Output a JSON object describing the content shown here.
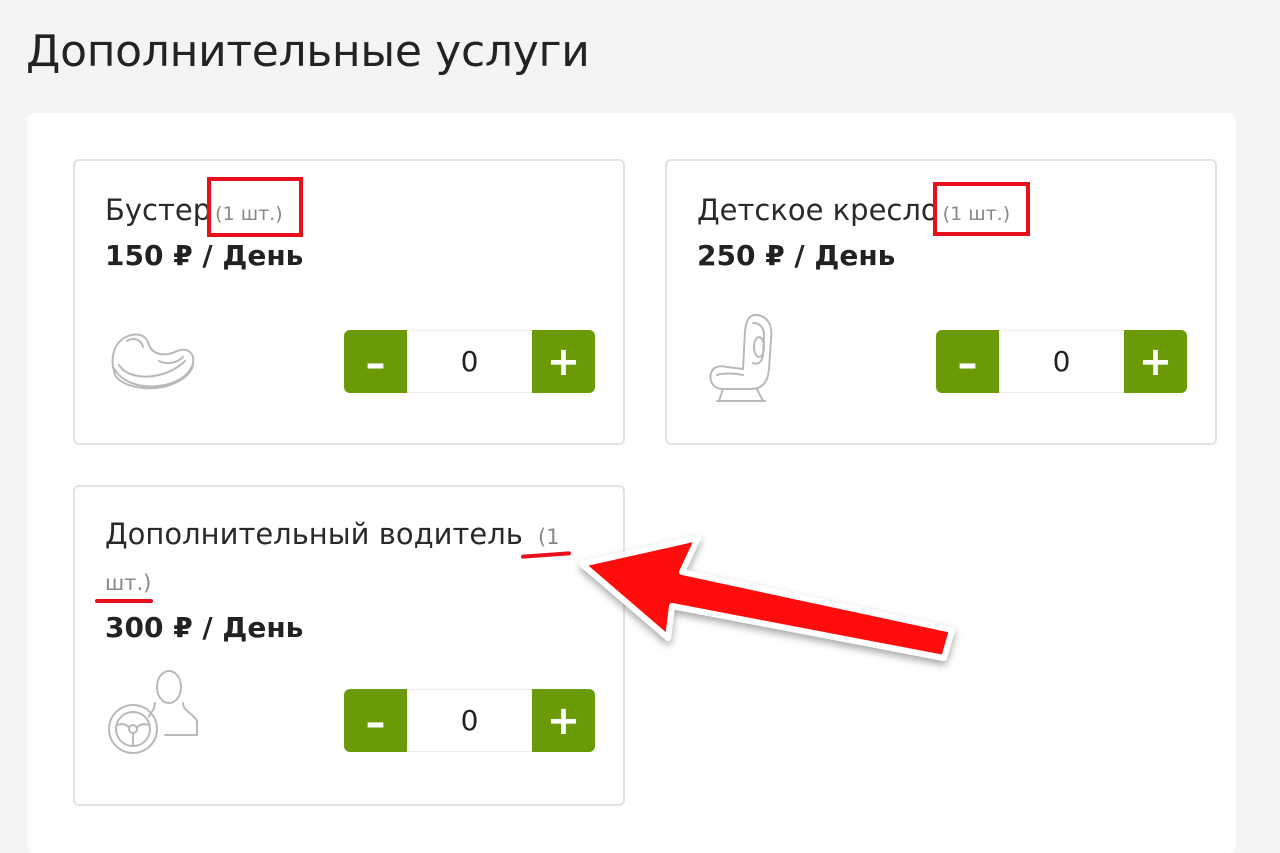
{
  "page": {
    "title": "Дополнительные услуги"
  },
  "services": [
    {
      "name": "Бустер",
      "qty_note": "(1 шт.)",
      "price": "150 ₽ / День",
      "icon": "booster-seat-icon",
      "count": "0",
      "minus": "–",
      "plus": "+"
    },
    {
      "name": "Детское кресло",
      "qty_note": "(1 шт.)",
      "price": "250 ₽ / День",
      "icon": "child-car-seat-icon",
      "count": "0",
      "minus": "–",
      "plus": "+"
    },
    {
      "name": "Дополнительный водитель",
      "qty_note": "(1",
      "qty_note_cont": "шт.)",
      "price": "300 ₽ / День",
      "icon": "driver-steering-wheel-icon",
      "count": "0",
      "minus": "–",
      "plus": "+"
    }
  ],
  "colors": {
    "accent": "#6a9a08",
    "annotation": "#e8101d"
  }
}
